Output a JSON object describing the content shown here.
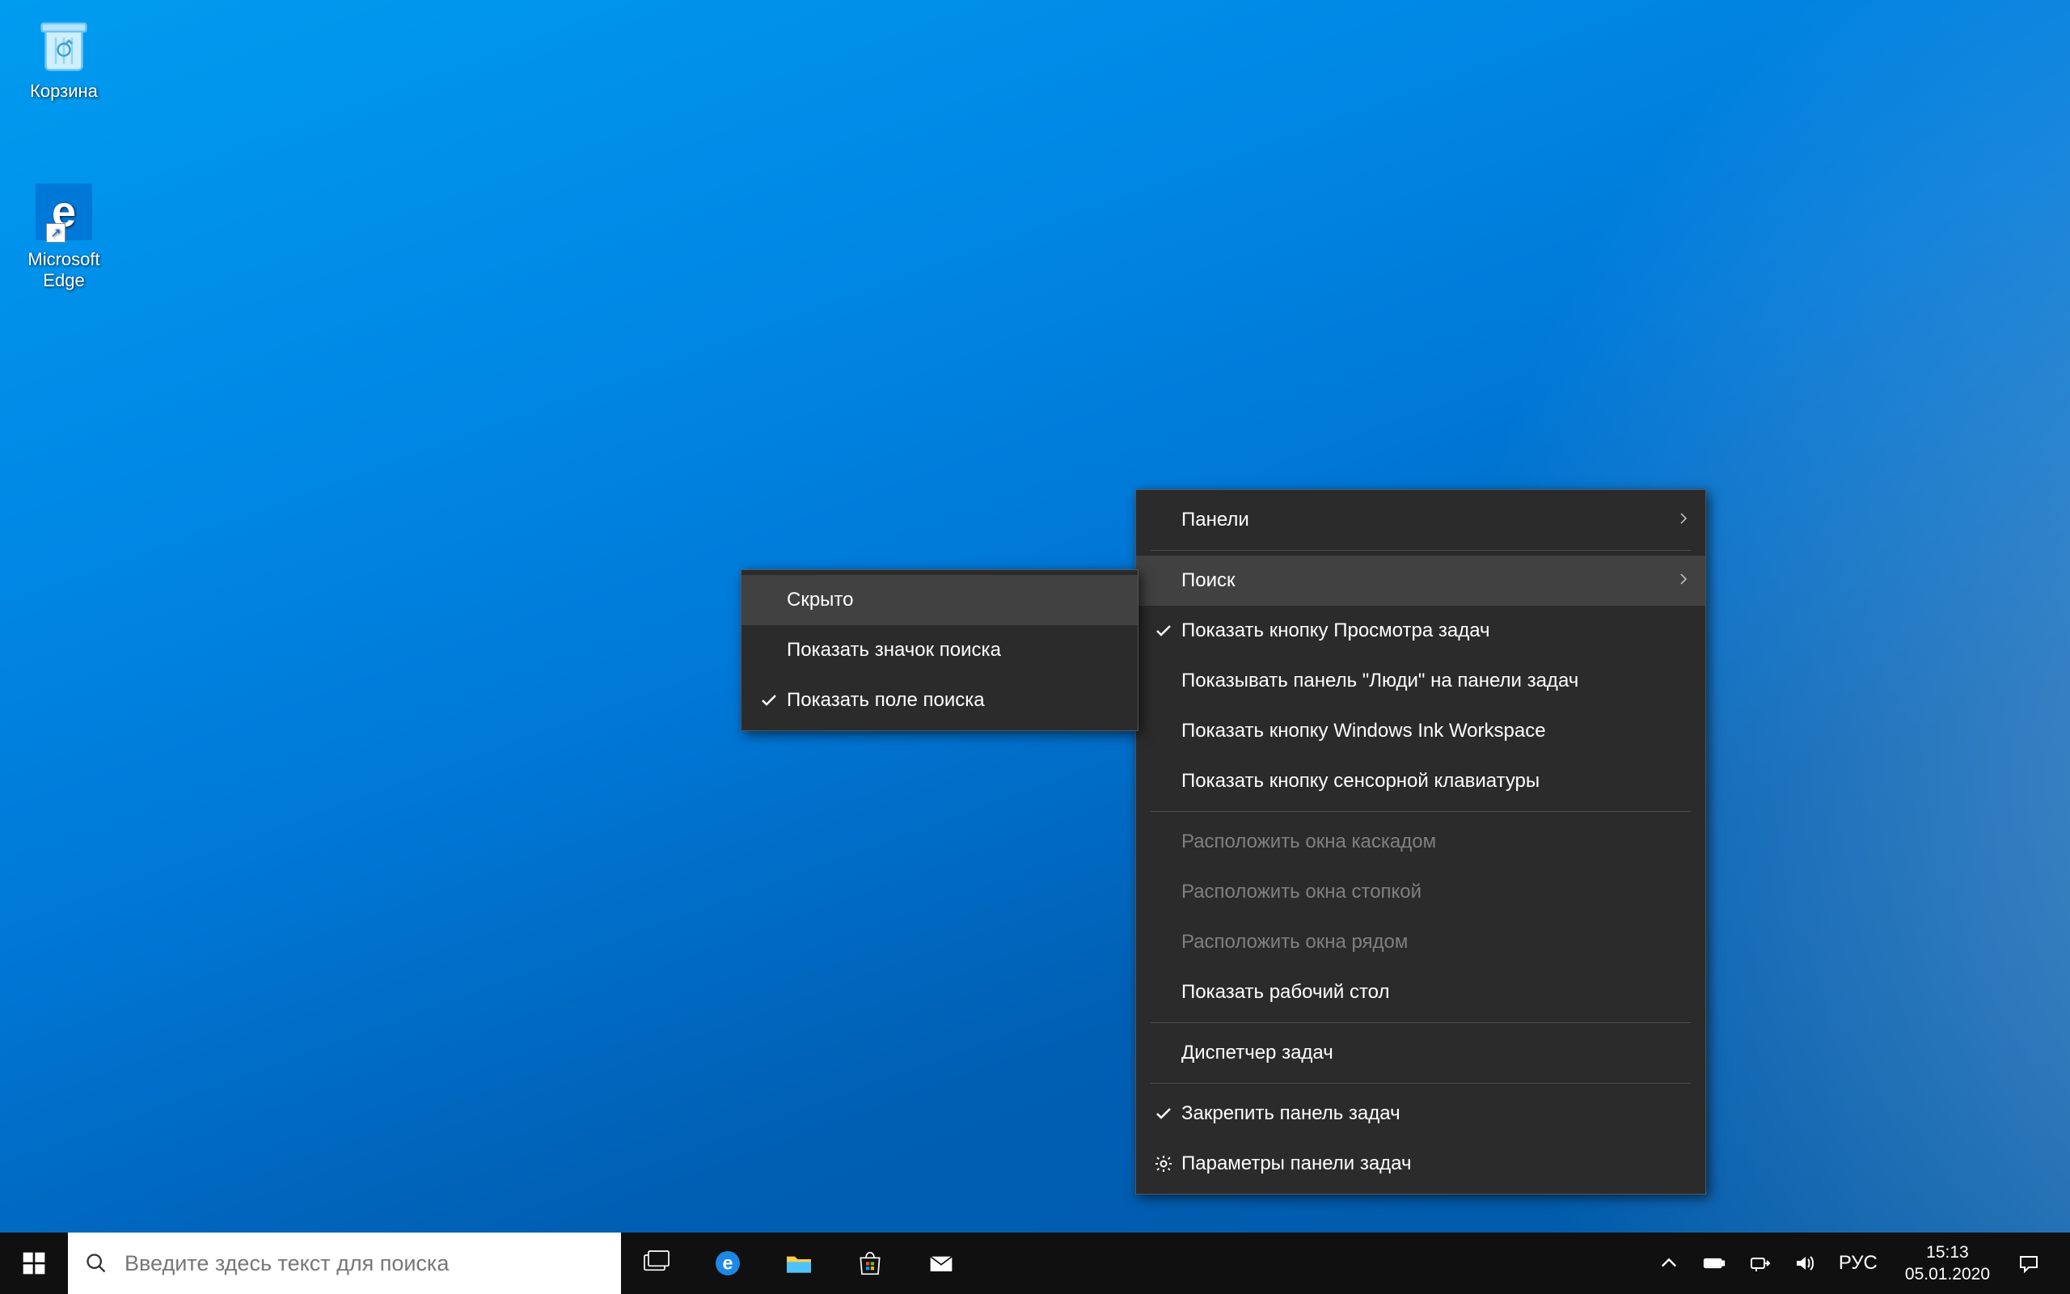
{
  "desktop": {
    "icons": [
      {
        "label": "Корзина"
      },
      {
        "label": "Microsoft Edge"
      }
    ]
  },
  "taskbar": {
    "search_placeholder": "Введите здесь текст для поиска",
    "language": "РУС",
    "time": "15:13",
    "date": "05.01.2020"
  },
  "main_menu": {
    "panels": "Панели",
    "search": "Поиск",
    "show_task_view": "Показать кнопку Просмотра задач",
    "show_people": "Показывать панель \"Люди\" на панели задач",
    "show_ink": "Показать кнопку Windows Ink Workspace",
    "show_touch_kb": "Показать кнопку сенсорной клавиатуры",
    "cascade": "Расположить окна каскадом",
    "stack": "Расположить окна стопкой",
    "side": "Расположить окна рядом",
    "show_desktop": "Показать рабочий стол",
    "task_manager": "Диспетчер задач",
    "lock_taskbar": "Закрепить панель задач",
    "settings": "Параметры панели задач"
  },
  "sub_menu": {
    "hidden": "Скрыто",
    "show_icon": "Показать значок поиска",
    "show_box": "Показать поле поиска"
  }
}
